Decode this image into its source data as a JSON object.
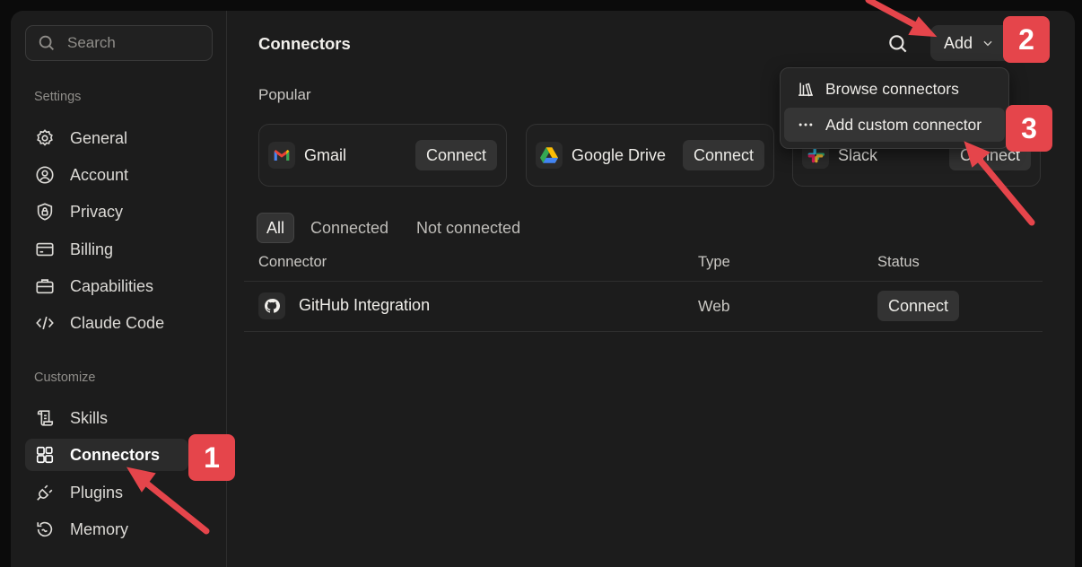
{
  "sidebar": {
    "search_placeholder": "Search",
    "settings_label": "Settings",
    "settings_items": [
      {
        "label": "General",
        "icon": "gear-icon"
      },
      {
        "label": "Account",
        "icon": "user-circle-icon"
      },
      {
        "label": "Privacy",
        "icon": "shield-lock-icon"
      },
      {
        "label": "Billing",
        "icon": "credit-card-icon"
      },
      {
        "label": "Capabilities",
        "icon": "toolbox-icon"
      },
      {
        "label": "Claude Code",
        "icon": "code-icon"
      }
    ],
    "customize_label": "Customize",
    "customize_items": [
      {
        "label": "Skills",
        "icon": "scroll-icon"
      },
      {
        "label": "Connectors",
        "icon": "grid-plus-icon",
        "active": true
      },
      {
        "label": "Plugins",
        "icon": "plug-icon"
      },
      {
        "label": "Memory",
        "icon": "history-icon"
      }
    ]
  },
  "header": {
    "title": "Connectors",
    "add_label": "Add"
  },
  "popular": {
    "label": "Popular",
    "cards": [
      {
        "name": "Gmail",
        "action": "Connect"
      },
      {
        "name": "Google Drive",
        "action": "Connect"
      },
      {
        "name": "Slack",
        "action": "Connect"
      }
    ]
  },
  "filters": [
    "All",
    "Connected",
    "Not connected"
  ],
  "table": {
    "columns": [
      "Connector",
      "Type",
      "Status"
    ],
    "rows": [
      {
        "name": "GitHub Integration",
        "type": "Web",
        "status": "Connect"
      }
    ]
  },
  "dropdown": {
    "items": [
      "Browse connectors",
      "Add custom connector"
    ]
  },
  "annotations": [
    "1",
    "2",
    "3"
  ],
  "colors": {
    "accent_badge": "#e5454b",
    "background": "#1c1c1c"
  }
}
